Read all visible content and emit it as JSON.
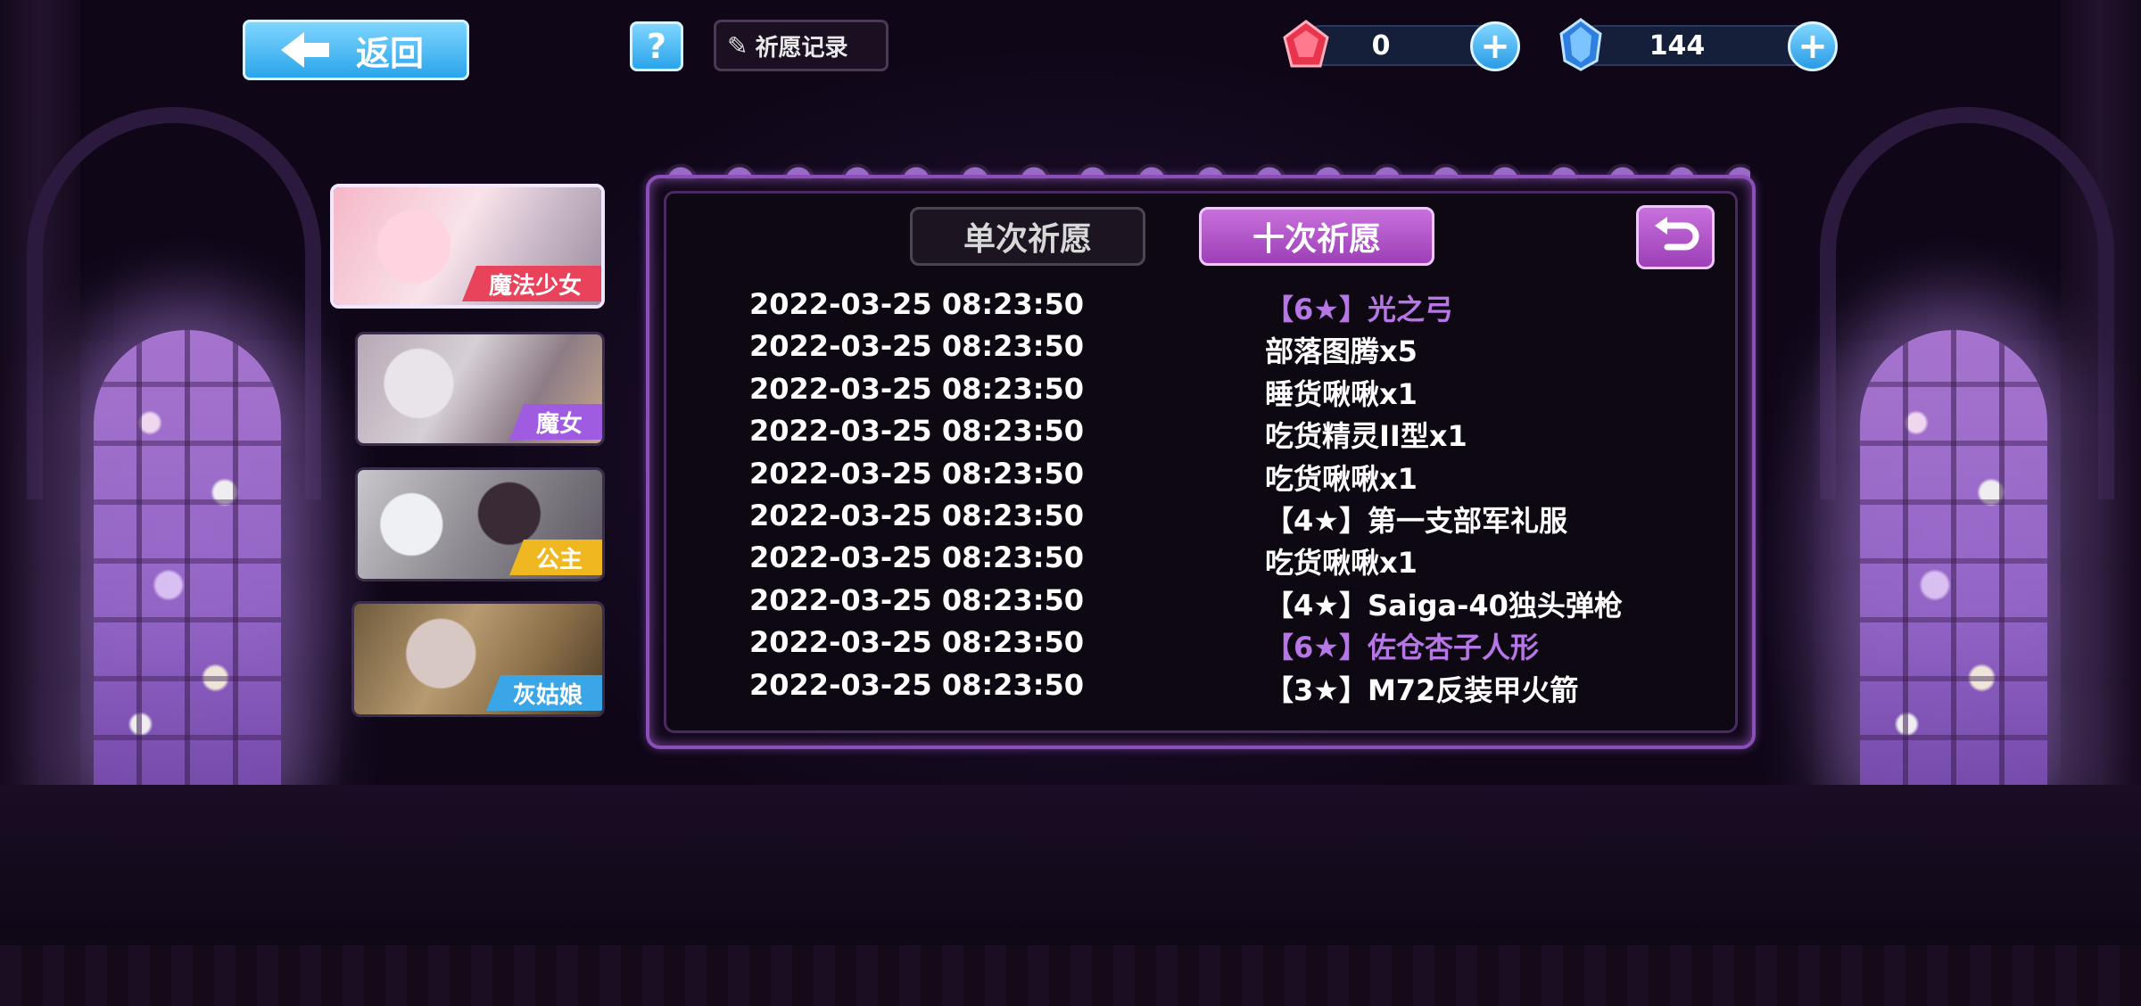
{
  "topbar": {
    "back_label": "返回",
    "help_label": "?",
    "record_label": "祈愿记录",
    "currency_red": "0",
    "currency_blue": "144"
  },
  "characters": [
    {
      "label": "魔法少女",
      "tag_color": "#e8435a",
      "selected": true
    },
    {
      "label": "魔女",
      "tag_color": "#a05ce0",
      "selected": false
    },
    {
      "label": "公主",
      "tag_color": "#f0b820",
      "selected": false
    },
    {
      "label": "灰姑娘",
      "tag_color": "#3aa6e8",
      "selected": false
    }
  ],
  "tabs": {
    "single": "单次祈愿",
    "ten": "十次祈愿",
    "active": "ten"
  },
  "records": [
    {
      "time": "2022-03-25 08:23:50",
      "item": "【6★】光之弓",
      "highlight": true
    },
    {
      "time": "2022-03-25 08:23:50",
      "item": "部落图腾x5",
      "highlight": false
    },
    {
      "time": "2022-03-25 08:23:50",
      "item": "睡货啾啾x1",
      "highlight": false
    },
    {
      "time": "2022-03-25 08:23:50",
      "item": "吃货精灵II型x1",
      "highlight": false
    },
    {
      "time": "2022-03-25 08:23:50",
      "item": "吃货啾啾x1",
      "highlight": false
    },
    {
      "time": "2022-03-25 08:23:50",
      "item": "【4★】第一支部军礼服",
      "highlight": false
    },
    {
      "time": "2022-03-25 08:23:50",
      "item": "吃货啾啾x1",
      "highlight": false
    },
    {
      "time": "2022-03-25 08:23:50",
      "item": "【4★】Saiga-40独头弹枪",
      "highlight": false
    },
    {
      "time": "2022-03-25 08:23:50",
      "item": "【6★】佐仓杏子人形",
      "highlight": true
    },
    {
      "time": "2022-03-25 08:23:50",
      "item": "【3★】M72反装甲火箭",
      "highlight": false
    }
  ],
  "colors": {
    "highlight": "#b676e6",
    "accent_blue": "#2aa4ea",
    "accent_purple": "#9d3fb8"
  },
  "icons": [
    "back-arrow-icon",
    "help-icon",
    "record-book-icon",
    "red-gem-icon",
    "blue-crystal-icon",
    "plus-icon",
    "return-icon"
  ]
}
